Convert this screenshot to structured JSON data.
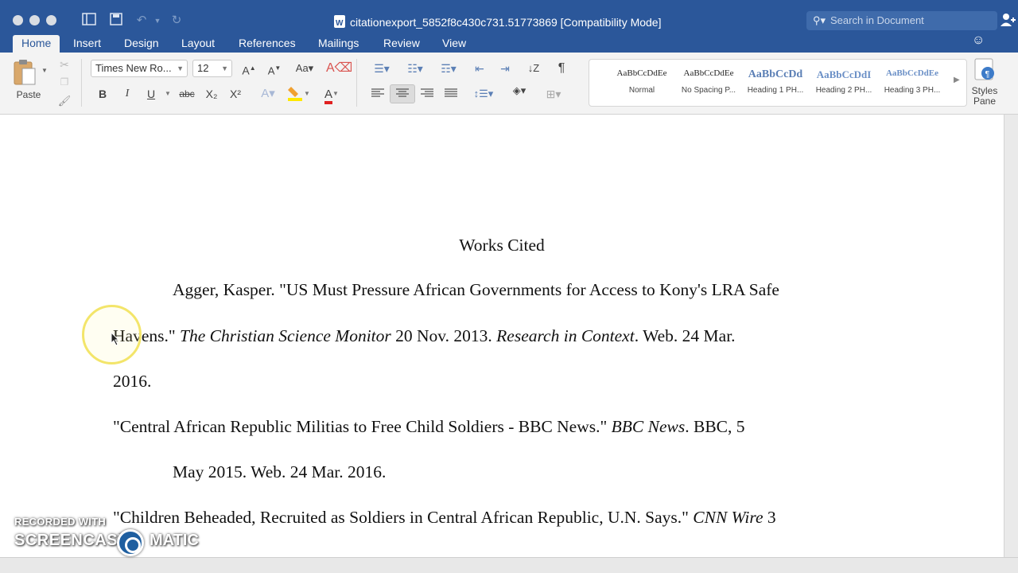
{
  "window": {
    "title": "citationexport_5852f8c430c731.51773869 [Compatibility Mode]",
    "search_placeholder": "Search in Document"
  },
  "tabs": [
    "Home",
    "Insert",
    "Design",
    "Layout",
    "References",
    "Mailings",
    "Review",
    "View"
  ],
  "ribbon": {
    "paste_label": "Paste",
    "font_name": "Times New Ro...",
    "font_size": "12",
    "bold": "B",
    "italic": "I",
    "underline": "U",
    "strikethrough": "abc",
    "subscript": "X₂",
    "superscript": "X²",
    "styles": [
      {
        "sample": "AaBbCcDdEe",
        "name": "Normal"
      },
      {
        "sample": "AaBbCcDdEe",
        "name": "No Spacing P..."
      },
      {
        "sample": "AaBbCcDd",
        "name": "Heading 1 PH..."
      },
      {
        "sample": "AaBbCcDdI",
        "name": "Heading 2 PH..."
      },
      {
        "sample": "AaBbCcDdEe",
        "name": "Heading 3 PH..."
      }
    ],
    "styles_pane_line1": "Styles",
    "styles_pane_line2": "Pane"
  },
  "document": {
    "heading": "Works Cited",
    "entry1_line1": "Agger, Kasper. \"US Must Pressure African Governments for Access to Kony's LRA Safe",
    "entry1_line2_a": "Havens.\" ",
    "entry1_line2_i1": "The Christian Science Monitor",
    "entry1_line2_b": " 20 Nov. 2013. ",
    "entry1_line2_i2": "Research in Context",
    "entry1_line2_c": ". Web. 24 Mar.",
    "entry1_line3": "2016.",
    "entry2_line1_a": "\"Central African Republic Militias to Free Child Soldiers - BBC News.\" ",
    "entry2_line1_i": "BBC News",
    "entry2_line1_b": ". BBC, 5",
    "entry2_line2": "May 2015. Web. 24 Mar. 2016.",
    "entry3_line1_a": "\"Children Beheaded, Recruited as Soldiers in Central African Republic, U.N. Says.\" ",
    "entry3_line1_i": "CNN Wire",
    "entry3_line1_b": " 3"
  },
  "watermark": {
    "line1": "RECORDED WITH",
    "line2_a": "SCREENCAST",
    "line2_b": "MATIC"
  },
  "colors": {
    "titlebar": "#2b579a",
    "ribbon": "#f3f3f3",
    "cursor_ring": "#f3e56a"
  }
}
